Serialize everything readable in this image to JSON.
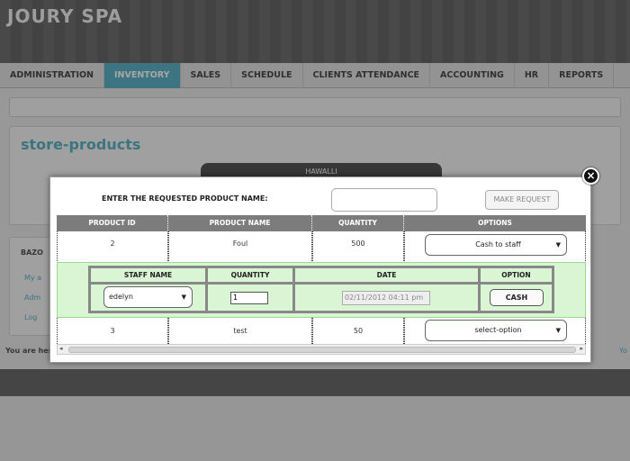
{
  "app": {
    "brand": "JOURY SPA"
  },
  "nav": {
    "items": [
      "ADMINISTRATION",
      "INVENTORY",
      "SALES",
      "SCHEDULE",
      "CLIENTS ATTENDANCE",
      "ACCOUNTING",
      "HR",
      "REPORTS"
    ],
    "active": "INVENTORY"
  },
  "page": {
    "title": "store-products",
    "store_tab": "HAWALLI",
    "side_title": "BAZO",
    "side_links": [
      "My a",
      "Adm",
      "Log"
    ],
    "here_text": "You are her",
    "right_link": "Yo"
  },
  "modal": {
    "request_label": "ENTER THE REQUESTED PRODUCT NAME:",
    "request_input_value": "",
    "request_button": "MAKE REQUEST",
    "close_glyph": "×",
    "columns": [
      "PRODUCT ID",
      "PRODUCT NAME",
      "QUANTITY",
      "OPTIONS"
    ],
    "rows": [
      {
        "id": "2",
        "name": "Foul",
        "quantity": "500",
        "option": "Cash to staff"
      },
      {
        "id": "3",
        "name": "test",
        "quantity": "50",
        "option": "select-option"
      }
    ],
    "sub": {
      "columns": [
        "STAFF NAME",
        "QUANTITY",
        "DATE",
        "OPTION"
      ],
      "staff": "edelyn",
      "quantity": "1",
      "date": "02/11/2012 04:11 pm",
      "button": "CASH"
    },
    "scroll": {
      "left": "◂",
      "right": "▸",
      "grip": "⁞"
    }
  }
}
